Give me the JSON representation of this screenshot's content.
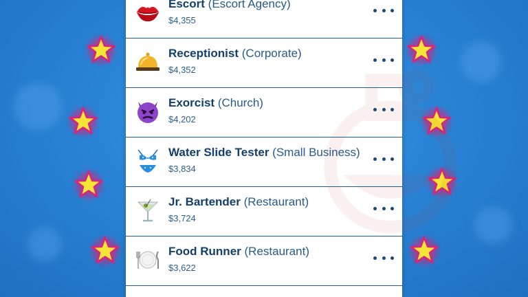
{
  "jobs": [
    {
      "title": "Escort",
      "employer": "(Escort Agency)",
      "salary": "$4,355",
      "icon": "kiss-lips-icon"
    },
    {
      "title": "Receptionist",
      "employer": "(Corporate)",
      "salary": "$4,352",
      "icon": "service-bell-icon"
    },
    {
      "title": "Exorcist",
      "employer": "(Church)",
      "salary": "$4,202",
      "icon": "devil-face-icon"
    },
    {
      "title": "Water Slide Tester",
      "employer": "(Small Business)",
      "salary": "$3,834",
      "icon": "bikini-icon"
    },
    {
      "title": "Jr. Bartender",
      "employer": "(Restaurant)",
      "salary": "$3,724",
      "icon": "martini-glass-icon"
    },
    {
      "title": "Food Runner",
      "employer": "(Restaurant)",
      "salary": "$3,622",
      "icon": "plate-cutlery-icon"
    }
  ],
  "colors": {
    "accent": "#123f6b",
    "divider": "#1e5c8f",
    "background": "#2a84d6",
    "star_fill": "#f6e437",
    "star_glow": "#d0287f"
  }
}
